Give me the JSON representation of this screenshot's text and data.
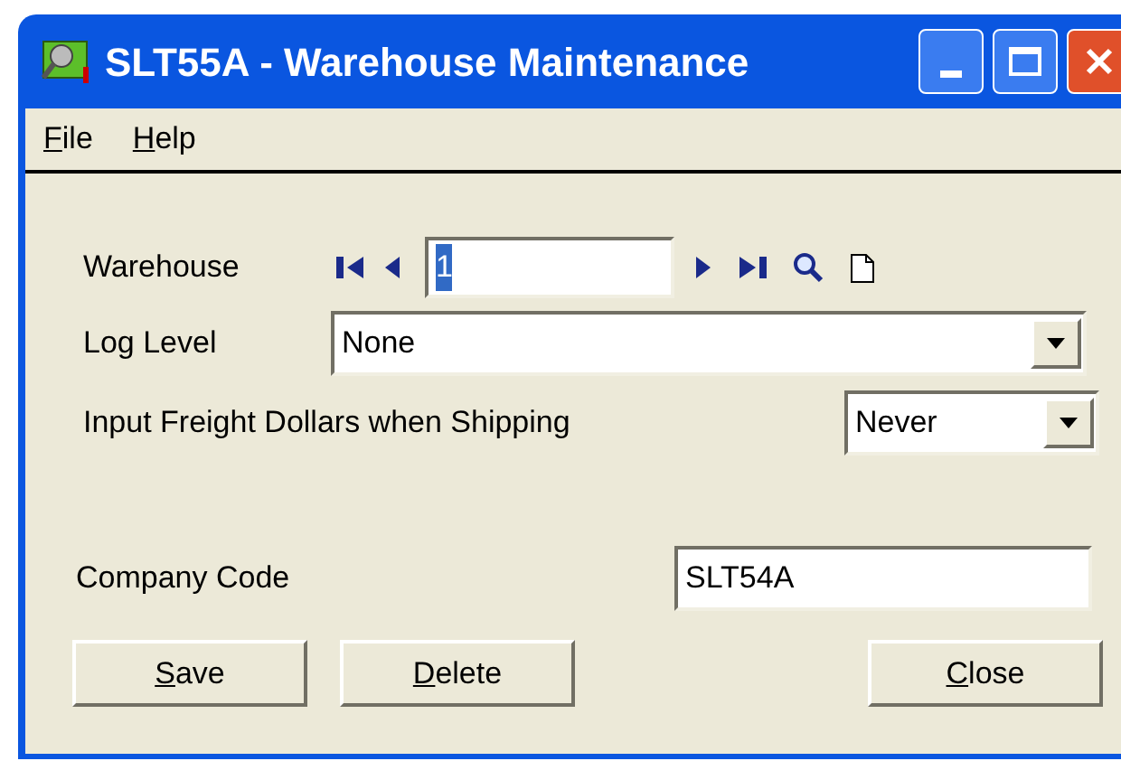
{
  "window": {
    "title": "SLT55A - Warehouse Maintenance"
  },
  "menu": [
    {
      "accel": "F",
      "rest": "ile"
    },
    {
      "accel": "H",
      "rest": "elp"
    }
  ],
  "warehouse": {
    "label": "Warehouse",
    "value": "1"
  },
  "log_level": {
    "label": "Log Level",
    "value": "None"
  },
  "freight": {
    "label": "Input Freight Dollars when Shipping",
    "value": "Never"
  },
  "company_code": {
    "label": "Company Code",
    "value": "SLT54A"
  },
  "buttons": [
    {
      "accel": "S",
      "rest": "ave"
    },
    {
      "accel": "D",
      "rest": "elete"
    },
    {
      "accel": "C",
      "rest": "lose"
    }
  ]
}
